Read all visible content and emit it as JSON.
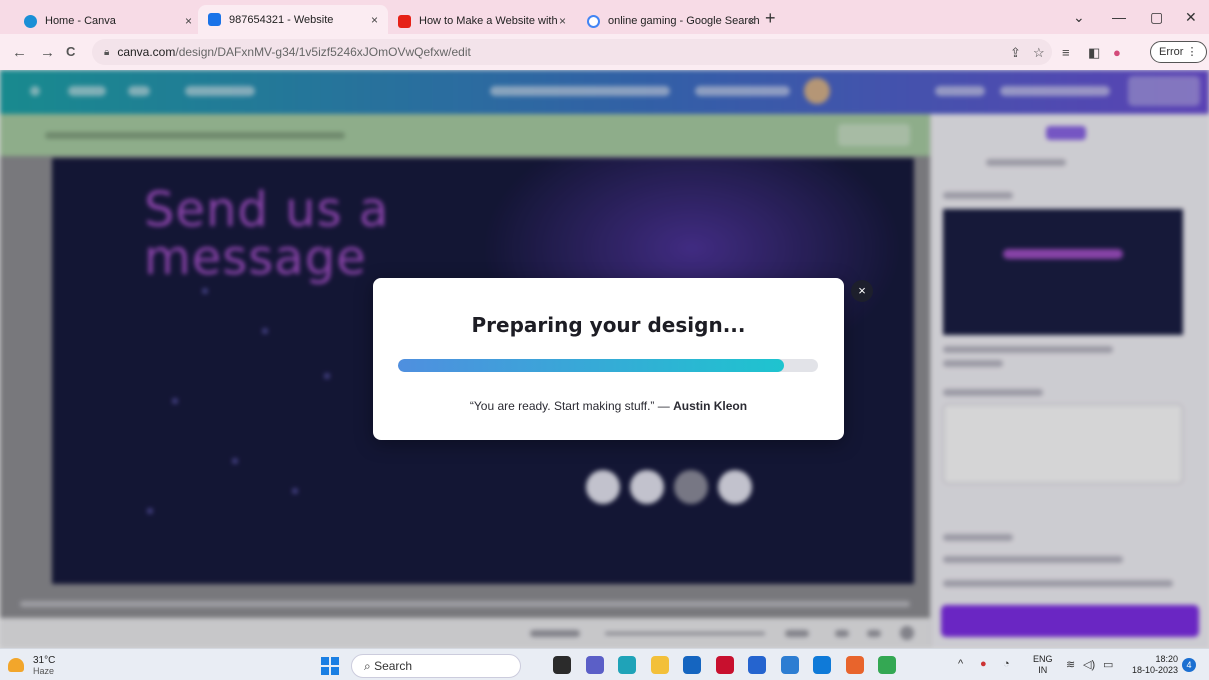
{
  "browser": {
    "tabs": [
      {
        "title": "Home - Canva",
        "favicon_color": "#1a8fd6"
      },
      {
        "title": "987654321 - Website",
        "favicon_color": "#1a73e8"
      },
      {
        "title": "How to Make a Website with Ca",
        "favicon_color": "#e62117"
      },
      {
        "title": "online gaming - Google Search",
        "favicon_color": "#4285f4"
      }
    ],
    "active_tab_index": 1,
    "tab_close": "×",
    "new_tab": "+",
    "window_controls": {
      "dropdown": "⌄",
      "minimize": "—",
      "restore": "▢",
      "close": "✕"
    },
    "nav": {
      "back": "←",
      "forward": "→",
      "reload": "C"
    },
    "url_host": "canva.com",
    "url_path": "/design/DAFxnMV-g34/1v5izf5246xJOmOVwQefxw/edit",
    "profile_chip": "Error"
  },
  "modal": {
    "title": "Preparing your design...",
    "progress": 0.92,
    "quote_text": "“You are ready. Start making stuff.” — ",
    "quote_author": "Austin Kleon",
    "close": "×"
  },
  "design_canvas": {
    "headline_line1": "Send us a",
    "headline_line2": "message"
  },
  "taskbar": {
    "temperature": "31°C",
    "condition": "Haze",
    "search_placeholder": "Search",
    "lang_top": "ENG",
    "lang_bottom": "IN",
    "time": "18:20",
    "date": "18-10-2023",
    "notification_count": "4",
    "apps": [
      {
        "name": "task-view",
        "color": "#2b2b2b"
      },
      {
        "name": "chat",
        "color": "#5b5fc7"
      },
      {
        "name": "edge",
        "color": "#1fa3b8"
      },
      {
        "name": "file-explorer",
        "color": "#f3c03a"
      },
      {
        "name": "mail",
        "color": "#1565c0"
      },
      {
        "name": "mcafee",
        "color": "#c8102e"
      },
      {
        "name": "todo",
        "color": "#2564cf"
      },
      {
        "name": "store",
        "color": "#2d7dd2"
      },
      {
        "name": "outlook",
        "color": "#0f7ad8"
      },
      {
        "name": "sublime",
        "color": "#e8642c"
      },
      {
        "name": "chrome",
        "color": "#34a853"
      }
    ]
  }
}
